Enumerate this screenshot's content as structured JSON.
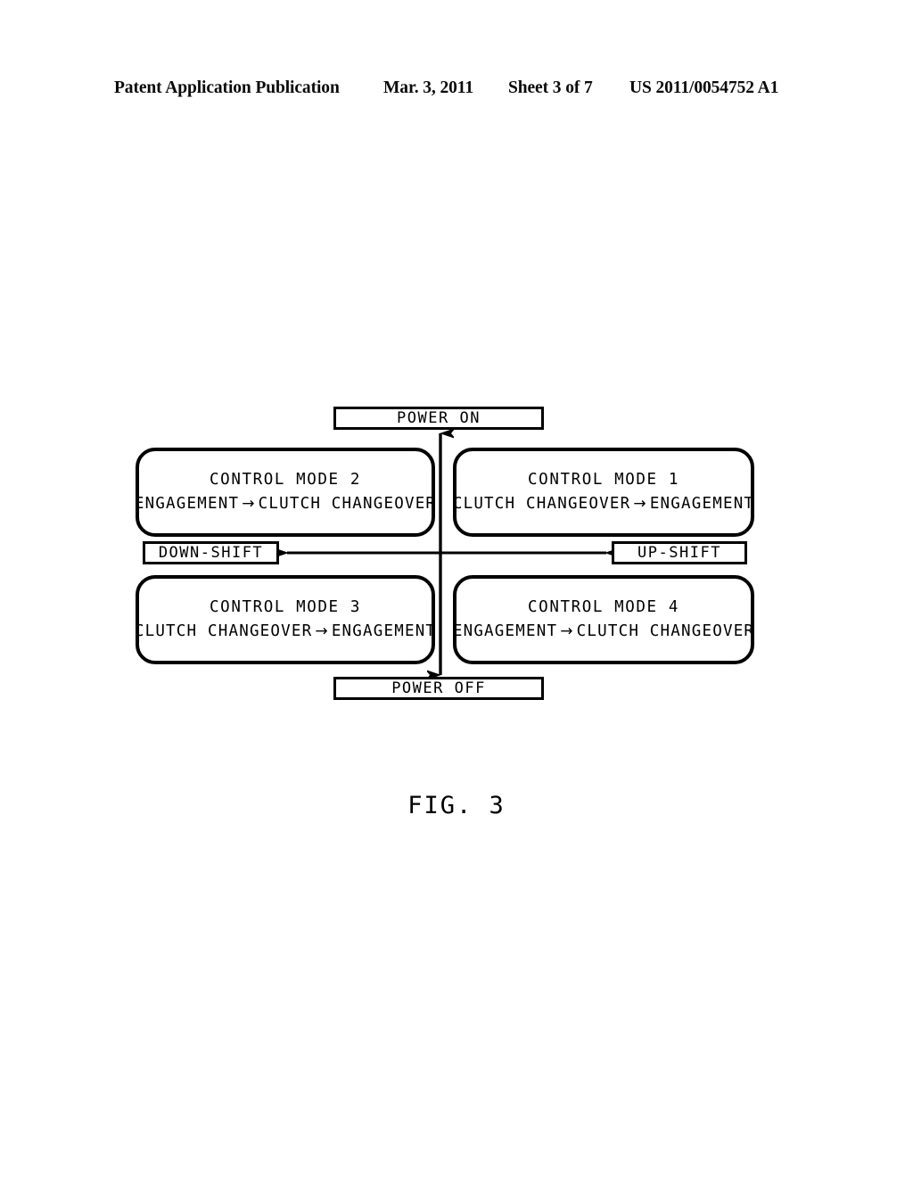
{
  "header": {
    "publication": "Patent Application Publication",
    "date": "Mar. 3, 2011",
    "sheet": "Sheet 3 of 7",
    "patent_number": "US 2011/0054752 A1"
  },
  "figure": {
    "caption": "FIG. 3",
    "axes": {
      "vertical_top_label": "POWER ON",
      "vertical_bottom_label": "POWER OFF",
      "horizontal_left_label": "DOWN-SHIFT",
      "horizontal_right_label": "UP-SHIFT"
    },
    "quadrants": [
      {
        "id": "control-mode-2",
        "title": "CONTROL MODE 2",
        "flow_from": "ENGAGEMENT",
        "flow_arrow": "→",
        "flow_to": "CLUTCH CHANGEOVER",
        "position": "top-left"
      },
      {
        "id": "control-mode-1",
        "title": "CONTROL MODE 1",
        "flow_from": "CLUTCH CHANGEOVER",
        "flow_arrow": "→",
        "flow_to": "ENGAGEMENT",
        "position": "top-right"
      },
      {
        "id": "control-mode-3",
        "title": "CONTROL MODE 3",
        "flow_from": "CLUTCH CHANGEOVER",
        "flow_arrow": "→",
        "flow_to": "ENGAGEMENT",
        "position": "bottom-left"
      },
      {
        "id": "control-mode-4",
        "title": "CONTROL MODE 4",
        "flow_from": "ENGAGEMENT",
        "flow_arrow": "→",
        "flow_to": "CLUTCH CHANGEOVER",
        "position": "bottom-right"
      }
    ]
  },
  "colors": {
    "ink": "#000000",
    "paper": "#ffffff"
  }
}
